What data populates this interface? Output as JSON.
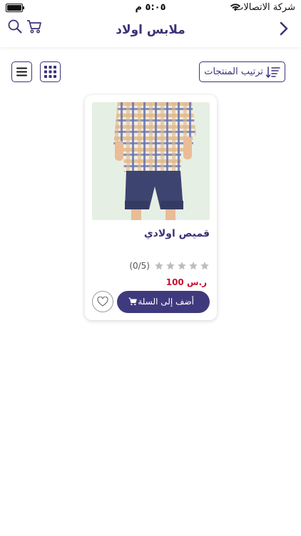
{
  "status_bar": {
    "carrier": "شركة الاتصالات",
    "time": "٥:٠٥ م"
  },
  "header": {
    "title": "ملابس اولاد",
    "icons": {
      "back": "chevron-right-icon",
      "cart": "cart-icon",
      "search": "search-icon"
    }
  },
  "toolbar": {
    "sort_label": "ترتيب المنتجات",
    "sort_icon": "sort-icon",
    "grid_icon": "grid-view-icon",
    "list_icon": "list-view-icon"
  },
  "products": [
    {
      "name": "قميص اولادي",
      "rating_text": "(0/5)",
      "rating_value": 0,
      "rating_max": 5,
      "price": "100 ر.س",
      "add_to_cart_label": "أضف إلى السلة",
      "favorite_icon": "heart-icon"
    }
  ],
  "colors": {
    "primary": "#3b3478",
    "button_bg": "#3f3a7e",
    "price": "#c8102e",
    "star_empty": "#bdbdbd"
  }
}
